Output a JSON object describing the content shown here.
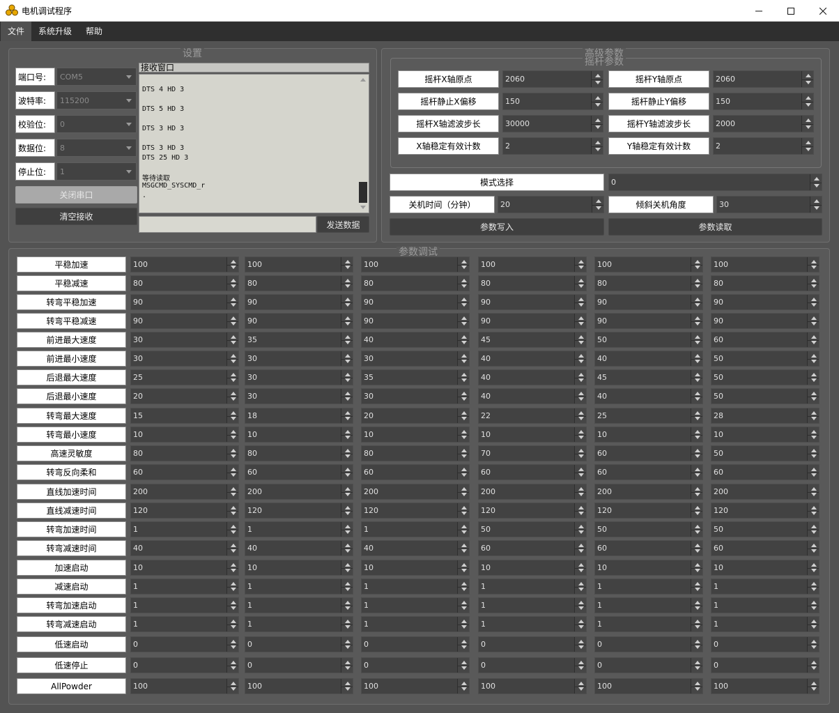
{
  "window": {
    "title": "电机调试程序",
    "minimize": "—",
    "maximize": "☐",
    "close": "✕"
  },
  "menu": [
    "文件",
    "系统升级",
    "帮助"
  ],
  "settings": {
    "title": "设置",
    "fields": [
      {
        "label": "端口号:",
        "value": "COM5"
      },
      {
        "label": "波特率:",
        "value": "115200"
      },
      {
        "label": "校验位:",
        "value": "0"
      },
      {
        "label": "数据位:",
        "value": "8"
      },
      {
        "label": "停止位:",
        "value": "1"
      }
    ],
    "close_port": "关闭串口",
    "clear_recv": "清空接收",
    "recv_title": "接收窗口",
    "recv_lines": [
      "DTS 4 HD 3",
      "DTS 5 HD 3",
      "DTS 3 HD 3",
      "DTS 3 HD 3",
      "DTS 25 HD 3",
      "等待读取",
      "MSGCMD_SYSCMD_r",
      "."
    ],
    "send_button": "发送数据",
    "send_value": ""
  },
  "advanced": {
    "title": "高级参数",
    "joystick_title": "摇杆参数",
    "joystick": [
      {
        "label": "摇杆X轴原点",
        "value": "2060"
      },
      {
        "label": "摇杆Y轴原点",
        "value": "2060"
      },
      {
        "label": "摇杆静止X偏移",
        "value": "150"
      },
      {
        "label": "摇杆静止Y偏移",
        "value": "150"
      },
      {
        "label": "摇杆X轴滤波步长",
        "value": "30000"
      },
      {
        "label": "摇杆Y轴滤波步长",
        "value": "2000"
      },
      {
        "label": "X轴稳定有效计数",
        "value": "2"
      },
      {
        "label": "Y轴稳定有效计数",
        "value": "2"
      }
    ],
    "mode_label": "模式选择",
    "mode_value": "0",
    "shutdown_label": "关机时间（分钟）",
    "shutdown_value": "20",
    "tilt_label": "倾斜关机角度",
    "tilt_value": "30",
    "write_button": "参数写入",
    "read_button": "参数读取"
  },
  "tuning": {
    "title": "参数调试",
    "rows": [
      {
        "label": "平稳加速",
        "values": [
          "100",
          "100",
          "100",
          "100",
          "100",
          "100"
        ]
      },
      {
        "label": "平稳减速",
        "values": [
          "80",
          "80",
          "80",
          "80",
          "80",
          "80"
        ]
      },
      {
        "label": "转弯平稳加速",
        "values": [
          "90",
          "90",
          "90",
          "90",
          "90",
          "90"
        ]
      },
      {
        "label": "转弯平稳减速",
        "values": [
          "90",
          "90",
          "90",
          "90",
          "90",
          "90"
        ]
      },
      {
        "label": "前进最大速度",
        "values": [
          "30",
          "35",
          "40",
          "45",
          "50",
          "60"
        ]
      },
      {
        "label": "前进最小速度",
        "values": [
          "30",
          "30",
          "30",
          "40",
          "40",
          "50"
        ]
      },
      {
        "label": "后退最大速度",
        "values": [
          "25",
          "30",
          "35",
          "40",
          "45",
          "50"
        ]
      },
      {
        "label": "后退最小速度",
        "values": [
          "20",
          "30",
          "30",
          "40",
          "40",
          "50"
        ]
      },
      {
        "label": "转弯最大速度",
        "values": [
          "15",
          "18",
          "20",
          "22",
          "25",
          "28"
        ]
      },
      {
        "label": "转弯最小速度",
        "values": [
          "10",
          "10",
          "10",
          "10",
          "10",
          "10"
        ]
      },
      {
        "label": "高速灵敏度",
        "values": [
          "80",
          "80",
          "80",
          "70",
          "60",
          "50"
        ]
      },
      {
        "label": "转弯反向柔和",
        "values": [
          "60",
          "60",
          "60",
          "60",
          "60",
          "60"
        ]
      },
      {
        "label": "直线加速时间",
        "values": [
          "200",
          "200",
          "200",
          "200",
          "200",
          "200"
        ]
      },
      {
        "label": "直线减速时间",
        "values": [
          "120",
          "120",
          "120",
          "120",
          "120",
          "120"
        ]
      },
      {
        "label": "转弯加速时间",
        "values": [
          "1",
          "1",
          "1",
          "50",
          "50",
          "50"
        ]
      },
      {
        "label": "转弯减速时间",
        "values": [
          "40",
          "40",
          "40",
          "60",
          "60",
          "60"
        ]
      },
      {
        "label": "加速启动",
        "values": [
          "10",
          "10",
          "10",
          "10",
          "10",
          "10"
        ]
      },
      {
        "label": "减速启动",
        "values": [
          "1",
          "1",
          "1",
          "1",
          "1",
          "1"
        ]
      },
      {
        "label": "转弯加速启动",
        "values": [
          "1",
          "1",
          "1",
          "1",
          "1",
          "1"
        ]
      },
      {
        "label": "转弯减速启动",
        "values": [
          "1",
          "1",
          "1",
          "1",
          "1",
          "1"
        ]
      },
      {
        "label": "低速启动",
        "values": [
          "0",
          "0",
          "0",
          "0",
          "0",
          "0"
        ]
      },
      {
        "label": "低速停止",
        "values": [
          "0",
          "0",
          "0",
          "0",
          "0",
          "0"
        ]
      },
      {
        "label": "AllPowder",
        "values": [
          "100",
          "100",
          "100",
          "100",
          "100",
          "100"
        ]
      }
    ]
  },
  "colors": {
    "background": "#535353",
    "panel": "#595959",
    "input": "#424242",
    "button": "#3f3f3f"
  }
}
